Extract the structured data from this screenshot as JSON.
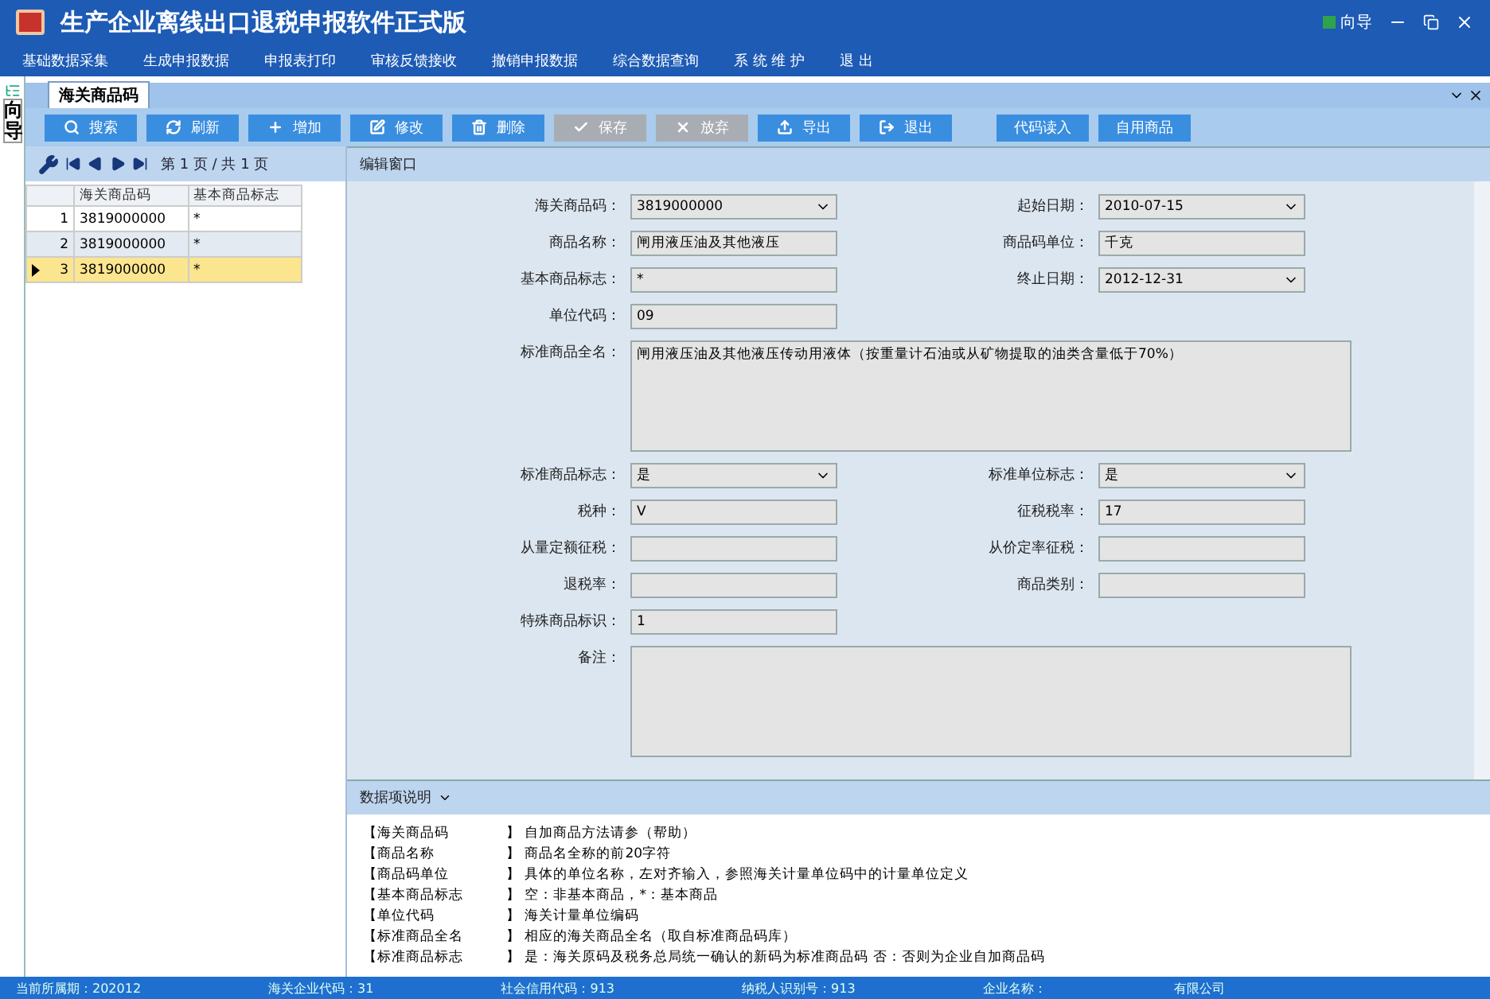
{
  "window": {
    "title": "生产企业离线出口退税申报软件正式版",
    "guide": "向导"
  },
  "menu": [
    "基础数据采集",
    "生成申报数据",
    "申报表打印",
    "审核反馈接收",
    "撤销申报数据",
    "综合数据查询",
    "系 统 维 护",
    "退  出"
  ],
  "side_tab": {
    "label": "向导"
  },
  "tabs": [
    {
      "label": "海关商品码",
      "selected": true
    }
  ],
  "toolbar": [
    {
      "label": "搜索",
      "kind": "icon",
      "disabled": false
    },
    {
      "label": "刷新",
      "kind": "icon",
      "disabled": false
    },
    {
      "label": "增加",
      "kind": "icon",
      "disabled": false
    },
    {
      "label": "修改",
      "kind": "icon",
      "disabled": false
    },
    {
      "label": "删除",
      "kind": "icon",
      "disabled": false
    },
    {
      "label": "保存",
      "kind": "icon",
      "disabled": true
    },
    {
      "label": "放弃",
      "kind": "icon",
      "disabled": true
    },
    {
      "label": "导出",
      "kind": "icon",
      "disabled": false
    },
    {
      "label": "退出",
      "kind": "icon",
      "disabled": false
    },
    {
      "label": "代码读入",
      "kind": "text",
      "disabled": false
    },
    {
      "label": "自用商品",
      "kind": "text",
      "disabled": false
    }
  ],
  "pager": {
    "text": "第 1 页 / 共 1 页"
  },
  "grid": {
    "columns": [
      "海关商品码",
      "基本商品标志"
    ],
    "rows": [
      {
        "no": "1",
        "cells": [
          "3819000000",
          "*"
        ],
        "selected": false
      },
      {
        "no": "2",
        "cells": [
          "3819000000",
          "*"
        ],
        "selected": false
      },
      {
        "no": "3",
        "cells": [
          "3819000000",
          "*"
        ],
        "selected": true
      }
    ]
  },
  "edit_panel": {
    "title": "编辑窗口",
    "rows": [
      [
        {
          "label": "海关商品码：",
          "value": "3819000000",
          "kind": "combo"
        },
        {
          "label": "起始日期：",
          "value": "2010-07-15",
          "kind": "combo"
        }
      ],
      [
        {
          "label": "商品名称：",
          "value": "闸用液压油及其他液压",
          "kind": "text"
        },
        {
          "label": "商品码单位：",
          "value": "千克",
          "kind": "text"
        }
      ],
      [
        {
          "label": "基本商品标志：",
          "value": "*",
          "kind": "text"
        },
        {
          "label": "终止日期：",
          "value": "2012-12-31",
          "kind": "combo"
        }
      ],
      [
        {
          "label": "单位代码：",
          "value": "09",
          "kind": "text"
        }
      ],
      [
        {
          "label": "标准商品全名：",
          "value": "闸用液压油及其他液压传动用液体（按重量计石油或从矿物提取的油类含量低于70%）",
          "kind": "area"
        }
      ],
      [
        {
          "label": "标准商品标志：",
          "value": "是",
          "kind": "combo"
        },
        {
          "label": "标准单位标志：",
          "value": "是",
          "kind": "combo"
        }
      ],
      [
        {
          "label": "税种：",
          "value": "V",
          "kind": "text"
        },
        {
          "label": "征税税率：",
          "value": "17",
          "kind": "text"
        }
      ],
      [
        {
          "label": "从量定额征税：",
          "kind": "text"
        },
        {
          "label": "从价定率征税：",
          "kind": "text"
        }
      ],
      [
        {
          "label": "退税率：",
          "kind": "text"
        },
        {
          "label": "商品类别：",
          "kind": "text"
        }
      ],
      [
        {
          "label": "特殊商品标识：",
          "value": "1",
          "kind": "text"
        }
      ],
      [
        {
          "label": "备注：",
          "kind": "area"
        }
      ]
    ]
  },
  "description": {
    "title": "数据项说明",
    "items": [
      {
        "term": "【海关商品码",
        "text": "】 自加商品方法请参（帮助）"
      },
      {
        "term": "【商品名称",
        "text": "】 商品名全称的前20字符"
      },
      {
        "term": "【商品码单位",
        "text": "】 具体的单位名称，左对齐输入，参照海关计量单位码中的计量单位定义"
      },
      {
        "term": "【基本商品标志",
        "text": "】 空：非基本商品，*：基本商品"
      },
      {
        "term": "【单位代码",
        "text": "】 海关计量单位编码"
      },
      {
        "term": "【标准商品全名",
        "text": "】 相应的海关商品全名（取自标准商品码库）"
      },
      {
        "term": "【标准商品标志",
        "text": "】 是：海关原码及税务总局统一确认的新码为标准商品码 否：否则为企业自加商品码"
      }
    ]
  },
  "status_bar": [
    "当前所属期：202012",
    "海关企业代码：31",
    "社会信用代码：913",
    "纳税人识别号：913",
    "企业名称：",
    "有限公司"
  ]
}
